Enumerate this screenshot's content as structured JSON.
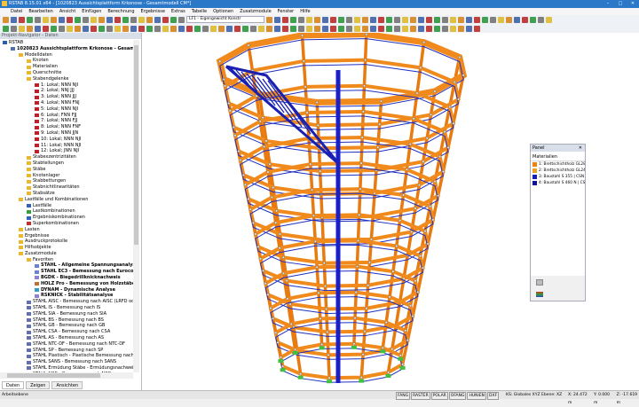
{
  "window": {
    "title": "RSTAB 8.15.01 x64 - [1020823 Aussichtsplattform Krkonose - Gesamtmodell CM*]",
    "min": "–",
    "max": "□",
    "close": "✕"
  },
  "menu": [
    "Datei",
    "Bearbeiten",
    "Ansicht",
    "Einfügen",
    "Berechnung",
    "Ergebnisse",
    "Extras",
    "Tabelle",
    "Optionen",
    "Zusatzmodule",
    "Fenster",
    "Hilfe"
  ],
  "toolbar": {
    "loadcase": "LF1 - Eigengewicht Konstr"
  },
  "navigator": {
    "title": "Projekt-Navigator - Daten",
    "tabs": [
      "Daten",
      "Zeigen",
      "Ansichten"
    ],
    "items": [
      {
        "label": "RSTAB",
        "level": 0,
        "icon": "#2b5fae"
      },
      {
        "label": "1020823 Aussichtsplattform Krkonose - Gesamtmodell CM*",
        "level": 1,
        "icon": "#5070b0",
        "bold": true
      },
      {
        "label": "Modelldaten",
        "level": 2,
        "icon": "#e8b830"
      },
      {
        "label": "Knoten",
        "level": 3,
        "icon": "#e8b830"
      },
      {
        "label": "Materialien",
        "level": 3,
        "icon": "#e8b830"
      },
      {
        "label": "Querschnitte",
        "level": 3,
        "icon": "#e8b830"
      },
      {
        "label": "Stabendgelenke",
        "level": 3,
        "icon": "#e8b830"
      },
      {
        "label": "1: Lokal; NNN NJI",
        "level": 4,
        "icon": "#c0202a"
      },
      {
        "label": "2: Lokal; NNJ JJJ",
        "level": 4,
        "icon": "#c0202a"
      },
      {
        "label": "3: Lokal; NNN JJJ",
        "level": 4,
        "icon": "#c0202a"
      },
      {
        "label": "4: Lokal; NNN FNJ",
        "level": 4,
        "icon": "#c0202a"
      },
      {
        "label": "5: Lokal; NNN NJI",
        "level": 4,
        "icon": "#c0202a"
      },
      {
        "label": "6: Lokal; FNN FJJ",
        "level": 4,
        "icon": "#c0202a"
      },
      {
        "label": "7: Lokal; NNN FJJ",
        "level": 4,
        "icon": "#c0202a"
      },
      {
        "label": "8: Lokal; NNN FNF",
        "level": 4,
        "icon": "#c0202a"
      },
      {
        "label": "9: Lokal; NNN JJN",
        "level": 4,
        "icon": "#c0202a"
      },
      {
        "label": "10: Lokal; NNN NJI",
        "level": 4,
        "icon": "#c0202a"
      },
      {
        "label": "11: Lokal; NNN NJI",
        "level": 4,
        "icon": "#c0202a"
      },
      {
        "label": "12: Lokal; JNN NJI",
        "level": 4,
        "icon": "#c0202a"
      },
      {
        "label": "Stabexzentrizitäten",
        "level": 3,
        "icon": "#e8b830"
      },
      {
        "label": "Stabteilungen",
        "level": 3,
        "icon": "#e8b830"
      },
      {
        "label": "Stäbe",
        "level": 3,
        "icon": "#e8b830"
      },
      {
        "label": "Knotenlager",
        "level": 3,
        "icon": "#e8b830"
      },
      {
        "label": "Stabbettungen",
        "level": 3,
        "icon": "#e8b830"
      },
      {
        "label": "Stabnichtlinearitäten",
        "level": 3,
        "icon": "#e8b830"
      },
      {
        "label": "Stabsätze",
        "level": 3,
        "icon": "#e8b830"
      },
      {
        "label": "Lastfälle und Kombinationen",
        "level": 2,
        "icon": "#e8b830"
      },
      {
        "label": "Lastfälle",
        "level": 3,
        "icon": "#3060c0"
      },
      {
        "label": "Lastkombinationen",
        "level": 3,
        "icon": "#30a040"
      },
      {
        "label": "Ergebniskombinationen",
        "level": 3,
        "icon": "#3060c0"
      },
      {
        "label": "Superkombinationen",
        "level": 3,
        "icon": "#c03030"
      },
      {
        "label": "Lasten",
        "level": 2,
        "icon": "#e8b830"
      },
      {
        "label": "Ergebnisse",
        "level": 2,
        "icon": "#e8b830"
      },
      {
        "label": "Ausdruckprotokolle",
        "level": 2,
        "icon": "#e8b830"
      },
      {
        "label": "Hilfsobjekte",
        "level": 2,
        "icon": "#e8b830"
      },
      {
        "label": "Zusatzmodule",
        "level": 2,
        "icon": "#e8b830"
      },
      {
        "label": "Favoriten",
        "level": 3,
        "icon": "#e8b830"
      },
      {
        "label": "STAHL - Allgemeine Spannungsanalyse von Stäben",
        "level": 4,
        "icon": "#7080d0",
        "bold": true
      },
      {
        "label": "STAHL EC3 - Bemessung nach Eurocode 3",
        "level": 4,
        "icon": "#7080d0",
        "bold": true
      },
      {
        "label": "BGDK - Biegedrillknicknachweis",
        "level": 4,
        "icon": "#9080d0",
        "bold": true
      },
      {
        "label": "HOLZ Pro - Bemessung von Holzstäben",
        "level": 4,
        "icon": "#c07030",
        "bold": true
      },
      {
        "label": "DYNAM - Dynamische Analyse",
        "level": 4,
        "icon": "#30a0c0",
        "bold": true
      },
      {
        "label": "RSKNICK - Stabilitätsanalyse",
        "level": 4,
        "icon": "#9080d0",
        "bold": true
      },
      {
        "label": "STAHL AISC - Bemessung nach AISC (LRFD oder ASD)",
        "level": 3,
        "icon": "#6070b0"
      },
      {
        "label": "STAHL IS - Bemessung nach IS",
        "level": 3,
        "icon": "#6070b0"
      },
      {
        "label": "STAHL SIA - Bemessung nach SIA",
        "level": 3,
        "icon": "#6070b0"
      },
      {
        "label": "STAHL BS - Bemessung nach BS",
        "level": 3,
        "icon": "#6070b0"
      },
      {
        "label": "STAHL GB - Bemessung nach GB",
        "level": 3,
        "icon": "#6070b0"
      },
      {
        "label": "STAHL CSA - Bemessung nach CSA",
        "level": 3,
        "icon": "#6070b0"
      },
      {
        "label": "STAHL AS - Bemessung nach AS",
        "level": 3,
        "icon": "#6070b0"
      },
      {
        "label": "STAHL NTC-DF - Bemessung nach NTC-DF",
        "level": 3,
        "icon": "#6070b0"
      },
      {
        "label": "STAHL SP - Bemessung nach SP",
        "level": 3,
        "icon": "#6070b0"
      },
      {
        "label": "STAHL Plastisch - Plastische Bemessung nach TSV (Teilschn",
        "level": 3,
        "icon": "#6070b0"
      },
      {
        "label": "STAHL SANS - Bemessung nach SANS",
        "level": 3,
        "icon": "#6070b0"
      },
      {
        "label": "STAHL Ermüdung Stäbe - Ermüdungsnachweis",
        "level": 3,
        "icon": "#6070b0"
      },
      {
        "label": "STAHL NBR - Bemessung nach NBR",
        "level": 3,
        "icon": "#6070b0"
      }
    ]
  },
  "panel": {
    "title": "Panel",
    "close": "✕",
    "section": "Materialien",
    "materials": [
      {
        "label": "1: Brettschichtholz GL28",
        "color": "#f08010"
      },
      {
        "label": "2: Brettschichtholz GL24",
        "color": "#f0a020"
      },
      {
        "label": "3: Baustahl S 355 | CSN",
        "color": "#1020c0"
      },
      {
        "label": "4: Baustahl S 460 N | CS",
        "color": "#1010a0"
      }
    ]
  },
  "status": {
    "left": "Arbeitsebene",
    "toggles": [
      "FANG",
      "RASTER",
      "POLAR",
      "OFANG",
      "HUNIEN",
      "DXF"
    ],
    "info": "KS: Globales XYZ Ebene: XZ",
    "x": "X: 24.472 m",
    "y": "Y: 0.000 m",
    "z": "Z: -17.619 m"
  }
}
